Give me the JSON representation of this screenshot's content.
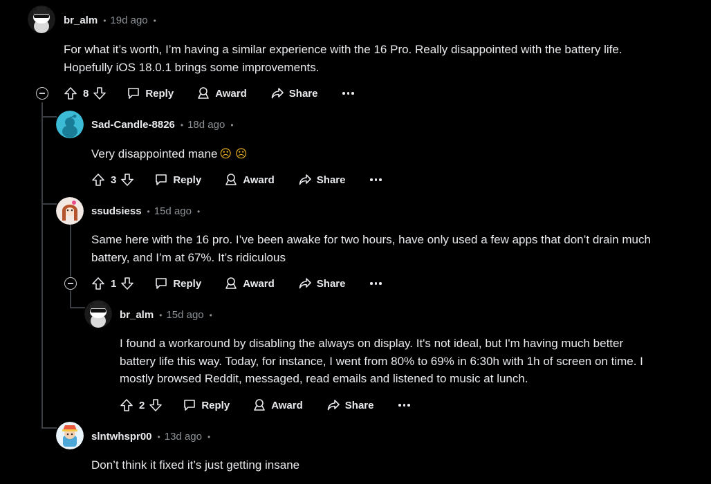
{
  "comments": [
    {
      "username": "br_alm",
      "time": "19d ago",
      "lines": [
        "For what it’s worth, I’m having a similar experience with the 16 Pro. Really disappointed with the battery life.",
        "Hopefully iOS 18.0.1 brings some improvements."
      ],
      "votes": "8"
    },
    {
      "username": "Sad-Candle-8826",
      "time": "18d ago",
      "lines": [
        "Very disappointed mane"
      ],
      "emoji": "☹ ☹",
      "votes": "3"
    },
    {
      "username": "ssudsiess",
      "time": "15d ago",
      "lines": [
        "Same here with the 16 pro. I’ve been awake for two hours, have only used a few apps that don’t drain much",
        "battery, and I’m at 67%. It’s ridiculous"
      ],
      "votes": "1"
    },
    {
      "username": "br_alm",
      "time": "15d ago",
      "lines": [
        "I found a workaround by disabling the always on display. It's not ideal, but I'm having much better",
        "battery life this way. Today, for instance, I went from 80% to 69% in 6:30h with 1h of screen on time. I",
        "mostly browsed Reddit, messaged, read emails and listened to music at lunch."
      ],
      "votes": "2"
    },
    {
      "username": "slntwhspr00",
      "time": "13d ago",
      "lines": [
        "Don’t think it fixed it’s just getting insane"
      ]
    }
  ],
  "actions": {
    "reply": "Reply",
    "award": "Award",
    "share": "Share"
  },
  "meta": {
    "separator": "•"
  }
}
